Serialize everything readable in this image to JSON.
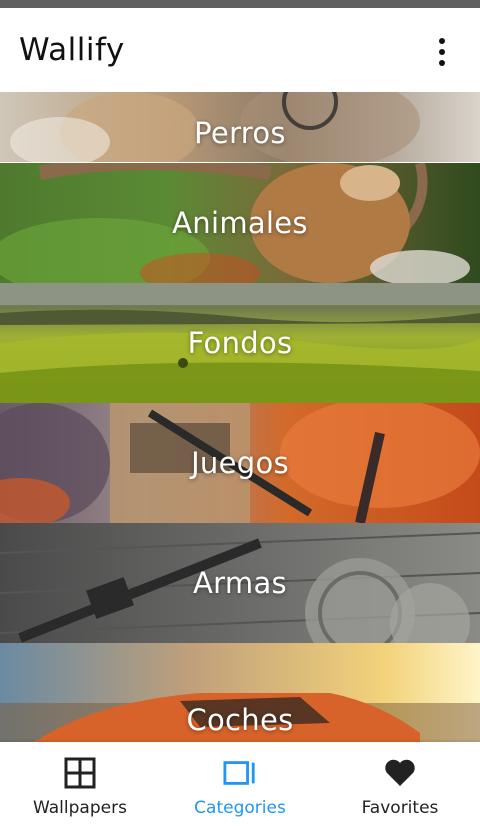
{
  "app": {
    "title": "Wallify",
    "menu_icon": "more-vert-icon"
  },
  "categories": [
    {
      "label": "Perros"
    },
    {
      "label": "Animales"
    },
    {
      "label": "Fondos"
    },
    {
      "label": "Juegos"
    },
    {
      "label": "Armas"
    },
    {
      "label": "Coches"
    }
  ],
  "bottom_nav": {
    "active_color": "#2196f3",
    "items": [
      {
        "label": "Wallpapers",
        "icon": "grid-icon",
        "active": false
      },
      {
        "label": "Categories",
        "icon": "categories-icon",
        "active": true
      },
      {
        "label": "Favorites",
        "icon": "heart-icon",
        "active": false
      }
    ]
  }
}
